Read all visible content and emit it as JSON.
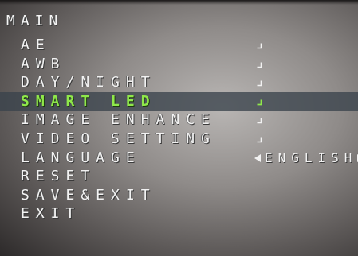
{
  "title": "MAIN",
  "items": [
    {
      "label": "AE",
      "enter_icon": "enter-icon"
    },
    {
      "label": "AWB",
      "enter_icon": "enter-icon"
    },
    {
      "label": "DAY/NIGHT",
      "enter_icon": "enter-icon"
    },
    {
      "label": "SMART LED",
      "enter_icon": "enter-icon",
      "selected": true
    },
    {
      "label": "IMAGE ENHANCE",
      "enter_icon": "enter-icon"
    },
    {
      "label": "VIDEO SETTING",
      "enter_icon": "enter-icon"
    },
    {
      "label": "LANGUAGE",
      "value": "ENGLISH"
    },
    {
      "label": "RESET"
    },
    {
      "label": "SAVE&EXIT"
    },
    {
      "label": "EXIT"
    }
  ],
  "colors": {
    "text": "#f2f2f2",
    "selected_text": "#8fe84a",
    "selected_bar": "#3a424c"
  }
}
